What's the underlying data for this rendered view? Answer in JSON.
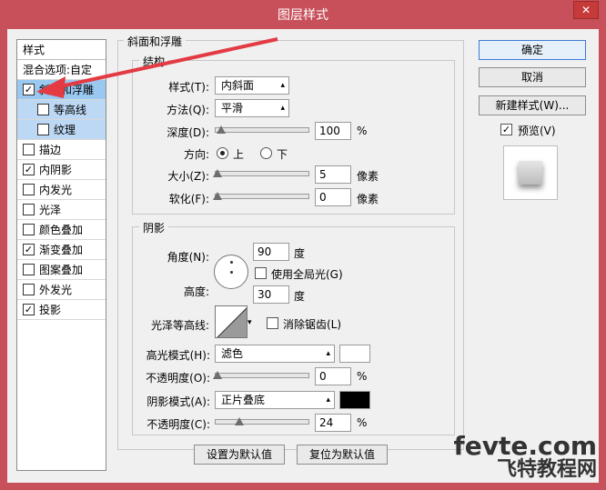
{
  "window": {
    "title": "图层样式",
    "close": "✕"
  },
  "styles_list": {
    "header": "样式",
    "blend_options": "混合选项:自定",
    "items": [
      {
        "label": "斜面和浮雕",
        "checked": "✓"
      },
      {
        "label": "等高线",
        "checked": ""
      },
      {
        "label": "纹理",
        "checked": ""
      },
      {
        "label": "描边",
        "checked": ""
      },
      {
        "label": "内阴影",
        "checked": "✓"
      },
      {
        "label": "内发光",
        "checked": ""
      },
      {
        "label": "光泽",
        "checked": ""
      },
      {
        "label": "颜色叠加",
        "checked": ""
      },
      {
        "label": "渐变叠加",
        "checked": "✓"
      },
      {
        "label": "图案叠加",
        "checked": ""
      },
      {
        "label": "外发光",
        "checked": ""
      },
      {
        "label": "投影",
        "checked": "✓"
      }
    ]
  },
  "bevel": {
    "section_title": "斜面和浮雕",
    "structure_title": "结构",
    "style_label": "样式(T):",
    "style_value": "内斜面",
    "technique_label": "方法(Q):",
    "technique_value": "平滑",
    "depth_label": "深度(D):",
    "depth_value": "100",
    "depth_unit": "%",
    "direction_label": "方向:",
    "direction_up": "上",
    "direction_down": "下",
    "size_label": "大小(Z):",
    "size_value": "5",
    "size_unit": "像素",
    "soften_label": "软化(F):",
    "soften_value": "0",
    "soften_unit": "像素"
  },
  "shading": {
    "title": "阴影",
    "angle_label": "角度(N):",
    "angle_value": "90",
    "angle_unit": "度",
    "global_light_label": "使用全局光(G)",
    "altitude_label": "高度:",
    "altitude_value": "30",
    "altitude_unit": "度",
    "gloss_label": "光泽等高线:",
    "antialias_label": "消除锯齿(L)",
    "highlight_mode_label": "高光模式(H):",
    "highlight_mode_value": "滤色",
    "highlight_color": "#ffffff",
    "highlight_opacity_label": "不透明度(O):",
    "highlight_opacity_value": "0",
    "highlight_opacity_unit": "%",
    "shadow_mode_label": "阴影模式(A):",
    "shadow_mode_value": "正片叠底",
    "shadow_color": "#000000",
    "shadow_opacity_label": "不透明度(C):",
    "shadow_opacity_value": "24",
    "shadow_opacity_unit": "%"
  },
  "defaults": {
    "set_default": "设置为默认值",
    "reset_default": "复位为默认值"
  },
  "right_panel": {
    "ok": "确定",
    "cancel": "取消",
    "new_style": "新建样式(W)...",
    "preview_label": "预览(V)",
    "preview_checked": "✓"
  },
  "watermark": {
    "line1": "fevte.com",
    "line2": "飞特教程网"
  }
}
